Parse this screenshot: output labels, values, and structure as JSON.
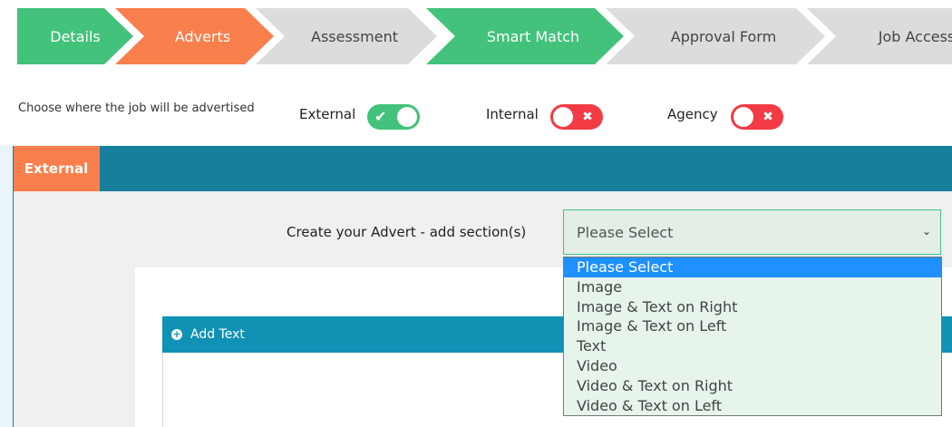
{
  "stepper": {
    "steps": [
      {
        "label": "Details"
      },
      {
        "label": "Adverts"
      },
      {
        "label": "Assessment"
      },
      {
        "label": "Smart Match"
      },
      {
        "label": "Approval Form"
      },
      {
        "label": "Job Access"
      }
    ]
  },
  "advertise": {
    "prompt": "Choose where the job will be advertised",
    "options": [
      {
        "label": "External",
        "state": "on"
      },
      {
        "label": "Internal",
        "state": "off"
      },
      {
        "label": "Agency",
        "state": "off"
      }
    ]
  },
  "panel": {
    "tab": "External",
    "create_label": "Create your Advert - add section(s)",
    "select_value": "Please Select",
    "add_text_label": "Add Text",
    "dropdown_options": [
      "Please Select",
      "Image",
      "Image & Text on Right",
      "Image & Text on Left",
      "Text",
      "Video",
      "Video & Text on Right",
      "Video & Text on Left"
    ]
  },
  "colors": {
    "green": "#42c27b",
    "orange": "#f97f4c",
    "teal": "#157f9c",
    "red": "#f23b45",
    "select_blue": "#1e90ff"
  }
}
